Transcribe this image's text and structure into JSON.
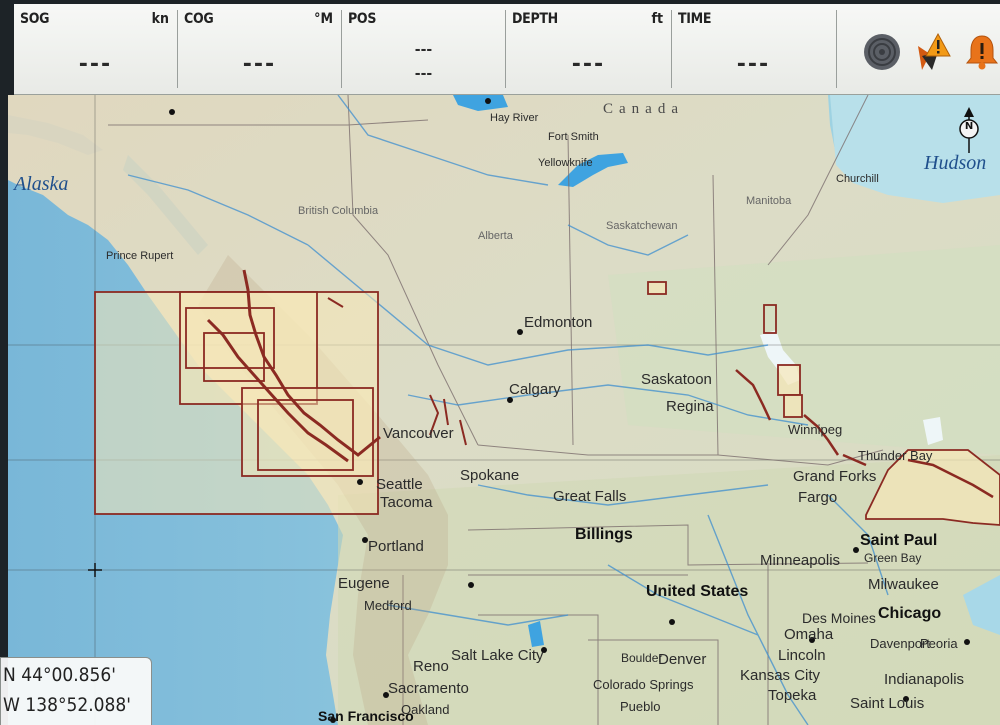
{
  "instrument_bar": {
    "sog": {
      "label": "SOG",
      "unit": "kn",
      "value": "---"
    },
    "cog": {
      "label": "COG",
      "unit": "°M",
      "value": "---"
    },
    "pos": {
      "label": "POS",
      "line1": "---",
      "line2": "---"
    },
    "depth": {
      "label": "DEPTH",
      "unit": "ft",
      "value": "---"
    },
    "time": {
      "label": "TIME",
      "value": "---"
    },
    "icons": [
      "sonar-icon",
      "anchor-alarm-icon",
      "alarm-bell-icon"
    ]
  },
  "map": {
    "north_indicator": "N",
    "labels": {
      "canada": "Canada",
      "alaska": "Alaska",
      "hudson": "Hudson",
      "united_states": "United States",
      "edmonton": "Edmonton",
      "calgary": "Calgary",
      "saskatoon": "Saskatoon",
      "regina": "Regina",
      "vancouver": "Vancouver",
      "seattle": "Seattle",
      "tacoma": "Tacoma",
      "portland": "Portland",
      "spokane": "Spokane",
      "billings": "Billings",
      "fargo": "Fargo",
      "saint_paul": "Saint Paul",
      "minneapolis": "Minneapolis",
      "milwaukee": "Milwaukee",
      "chicago": "Chicago",
      "omaha": "Omaha",
      "des_moines": "Des Moines",
      "lincoln": "Lincoln",
      "kansas_city": "Kansas City",
      "topeka": "Topeka",
      "saint_louis": "Saint Louis",
      "indianapolis": "Indianapolis",
      "denver": "Denver",
      "boulder": "Boulder",
      "colorado_springs": "Colorado Springs",
      "pueblo": "Pueblo",
      "salt_lake_city": "Salt Lake City",
      "reno": "Reno",
      "sacramento": "Sacramento",
      "oakland": "Oakland",
      "san_francisco": "San Francisco",
      "eugene": "Eugene",
      "medford": "Medford",
      "great_falls": "Great Falls",
      "green_bay": "Green Bay",
      "peoria": "Peoria",
      "davenport": "Davenport",
      "winnipeg": "Winnipeg",
      "thunder_bay": "Thunder Bay",
      "grand_forks": "Grand Forks",
      "churchill": "Churchill",
      "hay_river": "Hay River",
      "fort_smith": "Fort Smith",
      "yellowknife": "Yellowknife",
      "prince_rupert": "Prince Rupert",
      "manitoba": "Manitoba",
      "saskatchewan": "Saskatchewan",
      "alberta": "Alberta",
      "british_columbia": "British Columbia"
    }
  },
  "cursor_position": {
    "lat": "N 44°00.856'",
    "lon": "W 138°52.088'"
  },
  "colors": {
    "chart_outline": "#8b2a22",
    "chart_fill": "#f6e7b8",
    "water": "#7fb8d6"
  }
}
